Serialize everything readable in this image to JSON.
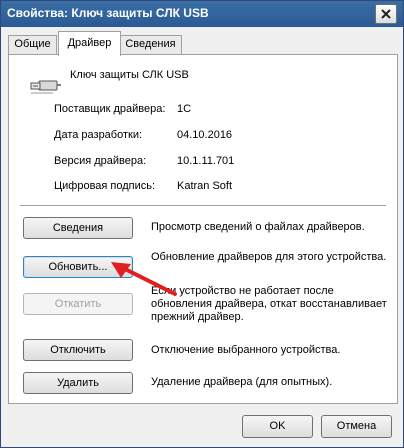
{
  "window": {
    "title": "Свойства: Ключ защиты СЛК USB"
  },
  "tabs": [
    {
      "label": "Общие",
      "active": false
    },
    {
      "label": "Драйвер",
      "active": true
    },
    {
      "label": "Сведения",
      "active": false
    }
  ],
  "device": {
    "name": "Ключ защиты СЛК USB",
    "icon": "usb-plug-icon"
  },
  "properties": [
    {
      "label": "Поставщик драйвера:",
      "value": "1С"
    },
    {
      "label": "Дата разработки:",
      "value": "04.10.2016"
    },
    {
      "label": "Версия драйвера:",
      "value": "10.1.11.701"
    },
    {
      "label": "Цифровая подпись:",
      "value": "Katran Soft"
    }
  ],
  "actions": [
    {
      "label": "Сведения",
      "description": "Просмотр сведений о файлах драйверов.",
      "enabled": true
    },
    {
      "label": "Обновить...",
      "description": "Обновление драйверов для этого устройства.",
      "enabled": true,
      "focused": true
    },
    {
      "label": "Откатить",
      "description": "Если устройство не работает после обновления драйвера, откат восстанавливает прежний драйвер.",
      "enabled": false
    },
    {
      "label": "Отключить",
      "description": "Отключение выбранного устройства.",
      "enabled": true
    },
    {
      "label": "Удалить",
      "description": "Удаление драйвера (для опытных).",
      "enabled": true
    }
  ],
  "footer": {
    "ok_label": "OK",
    "cancel_label": "Отмена"
  },
  "colors": {
    "title_bar": "#2f5f98",
    "annotation_arrow": "#e0201e",
    "disabled_text": "#a0a0a0"
  }
}
